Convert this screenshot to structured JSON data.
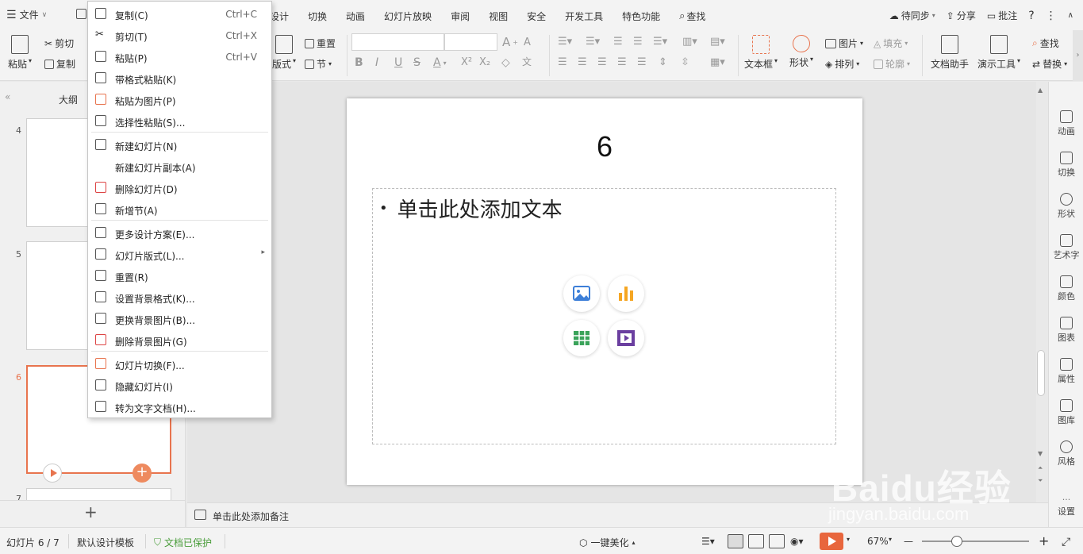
{
  "menubar": {
    "file_label": "文件",
    "tabs": [
      "设计",
      "切换",
      "动画",
      "幻灯片放映",
      "审阅",
      "视图",
      "安全",
      "开发工具",
      "特色功能"
    ],
    "search_label": "查找",
    "sync_label": "待同步",
    "share_label": "分享",
    "comment_label": "批注",
    "help_label": "?"
  },
  "ribbon": {
    "paste": "粘贴",
    "cut": "剪切",
    "copy": "复制",
    "layout": "版式",
    "reset": "重置",
    "section": "节",
    "font_a": "A",
    "bold": "B",
    "italic": "I",
    "underline": "U",
    "strike": "S",
    "textbox": "文本框",
    "shape": "形状",
    "picture": "图片",
    "arrange": "排列",
    "fill": "填充",
    "outline": "轮廓",
    "doc_helper": "文档助手",
    "presentation_tools": "演示工具",
    "find": "查找",
    "replace": "替换"
  },
  "leftpanel": {
    "outline_tab": "大纲",
    "slides": [
      {
        "num": "4"
      },
      {
        "num": "5"
      },
      {
        "num": "6"
      },
      {
        "num": "7"
      }
    ]
  },
  "context_menu": {
    "items": [
      {
        "label": "复制(C)",
        "shortcut": "Ctrl+C",
        "icon": "copy-icon"
      },
      {
        "label": "剪切(T)",
        "shortcut": "Ctrl+X",
        "icon": "scissors-icon"
      },
      {
        "label": "粘贴(P)",
        "shortcut": "Ctrl+V",
        "icon": "paste-icon"
      },
      {
        "label": "带格式粘贴(K)",
        "shortcut": "",
        "icon": "paste-format-icon"
      },
      {
        "label": "粘贴为图片(P)",
        "shortcut": "",
        "icon": "paste-image-icon"
      },
      {
        "label": "选择性粘贴(S)...",
        "shortcut": "",
        "icon": "paste-special-icon"
      },
      {
        "label": "新建幻灯片(N)",
        "shortcut": "",
        "icon": "new-slide-icon"
      },
      {
        "label": "新建幻灯片副本(A)",
        "shortcut": "",
        "icon": ""
      },
      {
        "label": "删除幻灯片(D)",
        "shortcut": "",
        "icon": "delete-slide-icon"
      },
      {
        "label": "新增节(A)",
        "shortcut": "",
        "icon": "new-section-icon"
      },
      {
        "label": "更多设计方案(E)...",
        "shortcut": "",
        "icon": "design-icon"
      },
      {
        "label": "幻灯片版式(L)...",
        "shortcut": "",
        "icon": "layout-icon"
      },
      {
        "label": "重置(R)",
        "shortcut": "",
        "icon": "reset-icon"
      },
      {
        "label": "设置背景格式(K)...",
        "shortcut": "",
        "icon": "background-format-icon"
      },
      {
        "label": "更换背景图片(B)...",
        "shortcut": "",
        "icon": "change-background-icon"
      },
      {
        "label": "删除背景图片(G)",
        "shortcut": "",
        "icon": "delete-background-icon"
      },
      {
        "label": "幻灯片切换(F)...",
        "shortcut": "",
        "icon": "transition-icon"
      },
      {
        "label": "隐藏幻灯片(I)",
        "shortcut": "",
        "icon": "hide-slide-icon"
      },
      {
        "label": "转为文字文档(H)...",
        "shortcut": "",
        "icon": "to-word-icon"
      }
    ]
  },
  "slide": {
    "title": "6",
    "placeholder_text": "单击此处添加文本",
    "bullet": "•"
  },
  "notes": {
    "placeholder": "单击此处添加备注"
  },
  "rightpanel": {
    "items": [
      "动画",
      "切换",
      "形状",
      "艺术字",
      "颜色",
      "图表",
      "属性",
      "图库",
      "风格",
      "设置"
    ]
  },
  "statusbar": {
    "slide_info": "幻灯片 6 / 7",
    "template": "默认设计模板",
    "protected": "文档已保护",
    "beautify": "一键美化",
    "zoom": "67%",
    "minus": "—",
    "plus": "+"
  },
  "watermark": {
    "main": "Baidu经验",
    "url": "jingyan.baidu.com"
  },
  "colors": {
    "accent": "#e8744e",
    "play_red": "#e8663d",
    "protected_green": "#4a9d3b",
    "picture_blue": "#3d7fd8",
    "chart_orange": "#f5a623",
    "table_green": "#3aa35a",
    "video_purple": "#6b3fa0"
  }
}
